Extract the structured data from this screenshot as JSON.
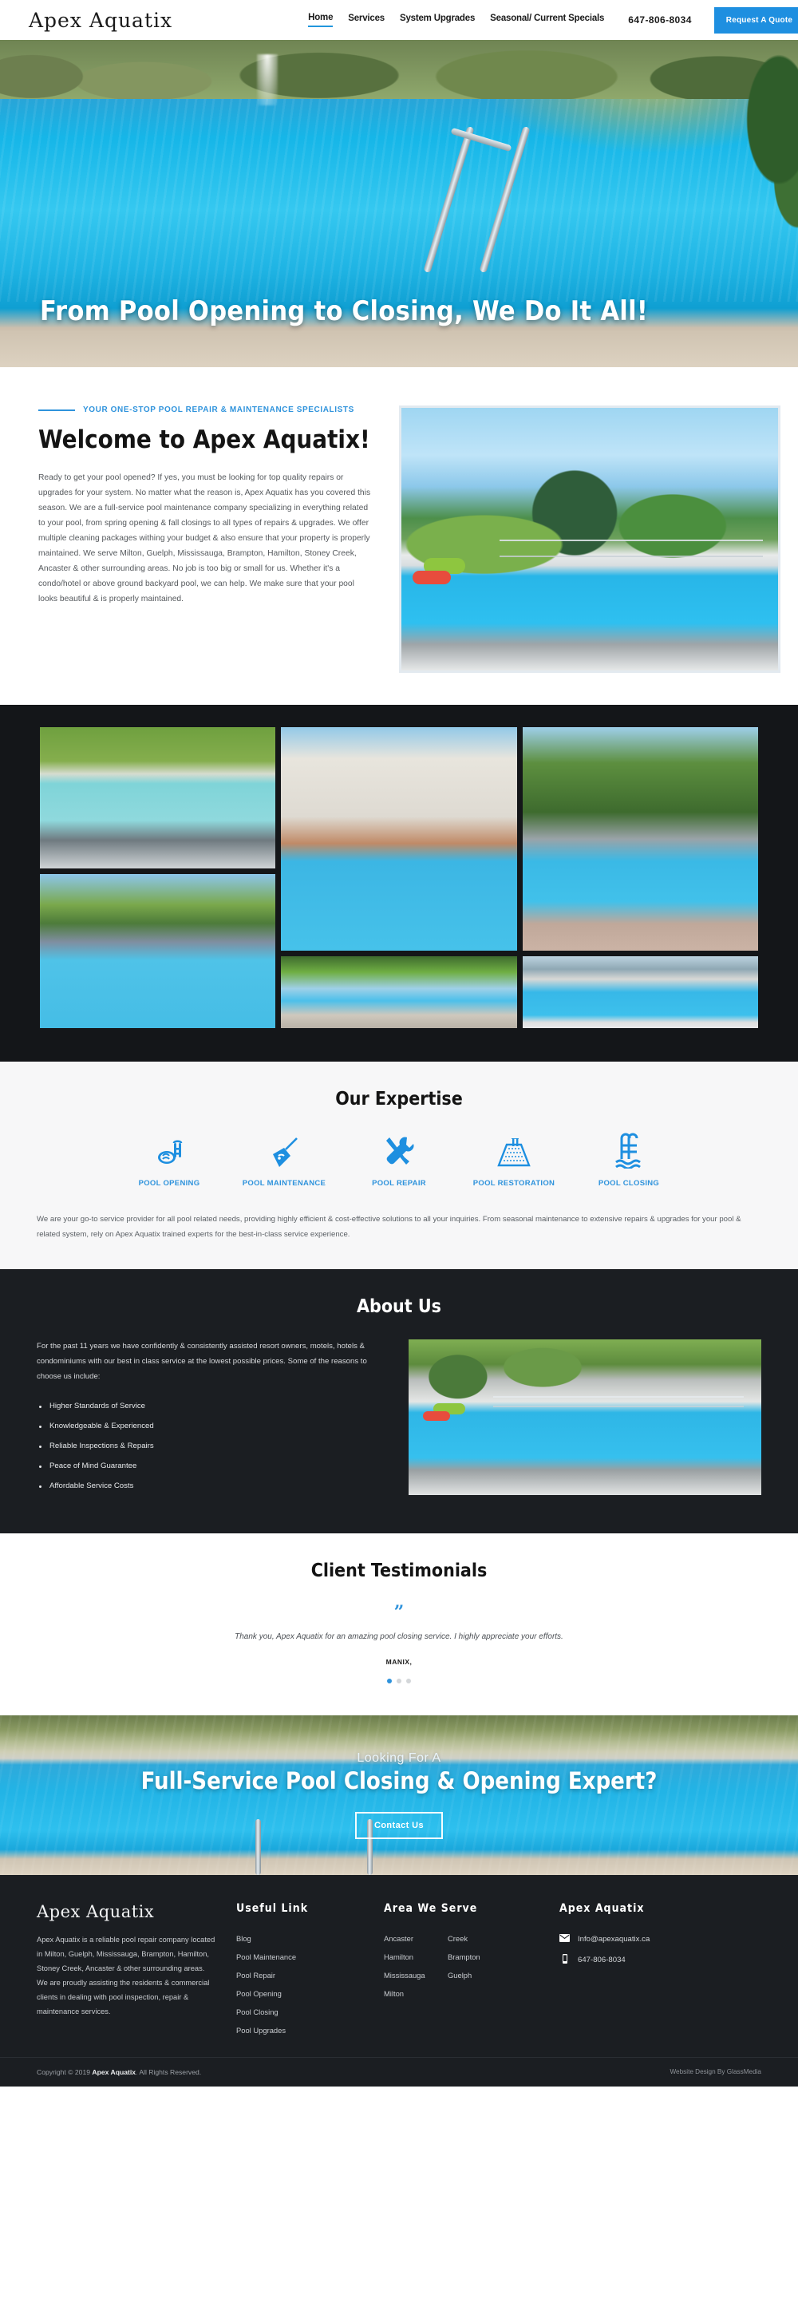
{
  "header": {
    "brand": "Apex Aquatix",
    "nav": [
      {
        "label": "Home",
        "active": true
      },
      {
        "label": "Services",
        "active": false
      },
      {
        "label": "System Upgrades",
        "active": false
      },
      {
        "label": "Seasonal/ Current Specials",
        "active": false
      }
    ],
    "phone": "647-806-8034",
    "cta_label": "Request A Quote"
  },
  "hero": {
    "title": "From Pool Opening to Closing, We Do It All!"
  },
  "welcome": {
    "eyebrow": "YOUR ONE-STOP POOL REPAIR & MAINTENANCE SPECIALISTS",
    "title": "Welcome to Apex Aquatix!",
    "body": "Ready to get your pool opened? If yes, you must be looking for top quality repairs or upgrades for your system. No matter what the reason is, Apex Aquatix has you covered this season. We are a full-service pool maintenance company specializing in everything related to your pool, from spring opening & fall closings to all types of repairs & upgrades. We offer multiple cleaning packages withing your budget & also ensure that your property is properly maintained. We serve Milton, Guelph, Mississauga, Brampton, Hamilton, Stoney Creek, Ancaster & other surrounding areas. No job is too big or small for us. Whether it's a condo/hotel or above ground backyard pool, we can help. We make sure that your pool looks beautiful & is properly maintained."
  },
  "gallery": {
    "items": [
      {
        "alt": "pool-with-spa-and-garden"
      },
      {
        "alt": "tropical-backyard-pool"
      },
      {
        "alt": "mansion-with-large-pool"
      },
      {
        "alt": "lawn-pool-with-stone-deck"
      },
      {
        "alt": "hedged-rectangular-pool"
      },
      {
        "alt": "hillside-modern-pool"
      }
    ]
  },
  "expertise": {
    "title": "Our Expertise",
    "items": [
      {
        "label": "POOL OPENING",
        "icon": "pool-opening-icon"
      },
      {
        "label": "POOL MAINTENANCE",
        "icon": "pool-skimmer-icon"
      },
      {
        "label": "POOL REPAIR",
        "icon": "wrench-screwdriver-icon"
      },
      {
        "label": "POOL RESTORATION",
        "icon": "pool-restoration-icon"
      },
      {
        "label": "POOL CLOSING",
        "icon": "pool-ladder-icon"
      }
    ],
    "description": "We are your go-to service provider for all pool related needs, providing highly efficient & cost-effective solutions to all your inquiries. From seasonal maintenance to extensive repairs & upgrades for your pool & related system, rely on Apex Aquatix trained experts for the best-in-class service experience."
  },
  "about": {
    "title": "About Us",
    "intro": "For the past 11 years we have confidently & consistently assisted resort owners, motels, hotels & condominiums with our best in class service at the lowest possible prices. Some of the reasons to choose us include:",
    "reasons": [
      "Higher Standards of Service",
      "Knowledgeable & Experienced",
      "Reliable Inspections & Repairs",
      "Peace of Mind Guarantee",
      "Affordable Service Costs"
    ]
  },
  "testimonials": {
    "title": "Client Testimonials",
    "quote_glyph": "”",
    "text": "Thank you, Apex Aquatix for an amazing pool closing service. I highly appreciate your efforts.",
    "author": "MANIX,"
  },
  "cta": {
    "subtitle": "Looking For A",
    "title": "Full-Service Pool Closing & Opening Expert?",
    "button": "Contact Us"
  },
  "footer": {
    "brand": "Apex Aquatix",
    "about": "Apex Aquatix is a reliable pool repair company located in Milton, Guelph, Mississauga, Brampton, Hamilton, Stoney Creek, Ancaster & other surrounding areas. We are proudly assisting the residents & commercial clients in dealing with pool inspection, repair & maintenance services.",
    "useful_link_title": "Useful Link",
    "useful_links": [
      "Blog",
      "Pool Maintenance",
      "Pool Repair",
      "Pool Opening",
      "Pool Closing",
      "Pool Upgrades"
    ],
    "area_title": "Area We Serve",
    "areas_col1": [
      "Ancaster",
      "Hamilton",
      "Mississauga",
      "Milton"
    ],
    "areas_col2": [
      "Creek",
      "Brampton",
      "Guelph"
    ],
    "contact_title": "Apex Aquatix",
    "email": "Info@apexaquatix.ca",
    "phone": "647-806-8034"
  },
  "copyright": {
    "prefix": "Copyright © 2019",
    "brand": "Apex Aquatix",
    "suffix": ". All Rights Reserved.",
    "credit": "Website Design By GlassMedia"
  },
  "colors": {
    "accent": "#2f93dc",
    "header_button": "#1e8fe0",
    "dark": "#1b1e22",
    "light_bg": "#f7f7f8"
  }
}
